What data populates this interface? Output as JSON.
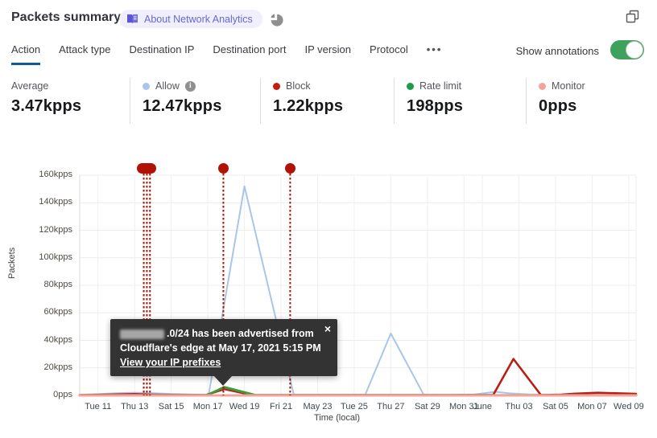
{
  "header": {
    "title": "Packets summary",
    "badge_label": "About Network Analytics",
    "icons": {
      "book_icon": "open-book",
      "pie_icon": "pie-chart",
      "popout_icon": "overlapping-windows"
    }
  },
  "tabs": {
    "items": [
      "Action",
      "Attack type",
      "Destination IP",
      "Destination port",
      "IP version",
      "Protocol"
    ],
    "active": "Action",
    "more_label": "•••"
  },
  "annotations_toggle": {
    "label": "Show annotations",
    "state": "on"
  },
  "stats": [
    {
      "label": "Average",
      "value": "3.47kpps",
      "dot_color": null,
      "has_info": false
    },
    {
      "label": "Allow",
      "value": "12.47kpps",
      "dot_color": "#a9c6e9",
      "has_info": true
    },
    {
      "label": "Block",
      "value": "1.22kpps",
      "dot_color": "#c21b10",
      "has_info": false
    },
    {
      "label": "Rate limit",
      "value": "198pps",
      "dot_color": "#1f9c49",
      "has_info": false
    },
    {
      "label": "Monitor",
      "value": "0pps",
      "dot_color": "#f5a49c",
      "has_info": false
    }
  ],
  "colors": {
    "tab_underline": "#115a93",
    "toggle_on": "#3da35c",
    "badge_text": "#6b66d9",
    "badge_bg": "#f0effd",
    "annotation_red": "#b01205"
  },
  "tooltip": {
    "line1_suffix": ".0/24 has been advertised from",
    "line2": "Cloudflare's edge at May 17, 2021 5:15 PM",
    "link": "View your IP prefixes",
    "close": "×",
    "ip_redacted": true
  },
  "chart_data": {
    "type": "line",
    "xlabel": "Time (local)",
    "ylabel": "Packets",
    "x_domain_note": "days since May 10 2021, 0 to 30.4",
    "ylim_kpps": [
      0,
      160
    ],
    "grid": true,
    "annotation_color": "#a81505",
    "y_ticks": [
      {
        "v": 0,
        "label": "0pps"
      },
      {
        "v": 20,
        "label": "20kpps"
      },
      {
        "v": 40,
        "label": "40kpps"
      },
      {
        "v": 60,
        "label": "60kpps"
      },
      {
        "v": 80,
        "label": "80kpps"
      },
      {
        "v": 100,
        "label": "100kpps"
      },
      {
        "v": 120,
        "label": "120kpps"
      },
      {
        "v": 140,
        "label": "140kpps"
      },
      {
        "v": 160,
        "label": "160kpps"
      }
    ],
    "x_ticks": [
      {
        "d": 1,
        "label": "Tue 11"
      },
      {
        "d": 3,
        "label": "Thu 13"
      },
      {
        "d": 5,
        "label": "Sat 15"
      },
      {
        "d": 7,
        "label": "Mon 17"
      },
      {
        "d": 9,
        "label": "Wed 19"
      },
      {
        "d": 11,
        "label": "Fri 21"
      },
      {
        "d": 13,
        "label": "May 23"
      },
      {
        "d": 15,
        "label": "Tue 25"
      },
      {
        "d": 17,
        "label": "Thu 27"
      },
      {
        "d": 19,
        "label": "Sat 29"
      },
      {
        "d": 21,
        "label": "Mon 31"
      },
      {
        "d": 22,
        "label": "June"
      },
      {
        "d": 24,
        "label": "Thu 03"
      },
      {
        "d": 26,
        "label": "Sat 05"
      },
      {
        "d": 28,
        "label": "Mon 07"
      },
      {
        "d": 30,
        "label": "Wed 09"
      }
    ],
    "series": [
      {
        "name": "Allow",
        "color": "#a9c6e9",
        "width": 2,
        "points": [
          [
            0,
            0.4
          ],
          [
            1,
            1
          ],
          [
            2,
            1.6
          ],
          [
            3,
            2
          ],
          [
            4,
            1.6
          ],
          [
            5,
            1.1
          ],
          [
            6,
            0.7
          ],
          [
            6.9,
            0.4
          ],
          [
            7.05,
            0.6
          ],
          [
            9,
            152
          ],
          [
            11.7,
            0.5
          ],
          [
            13,
            0.4
          ],
          [
            15.6,
            0.4
          ],
          [
            17,
            45
          ],
          [
            18.8,
            0.4
          ],
          [
            20,
            0.3
          ],
          [
            21.5,
            0.6
          ],
          [
            22.1,
            1.6
          ],
          [
            22.7,
            2.6
          ],
          [
            23.5,
            1.5
          ],
          [
            24.5,
            0.8
          ],
          [
            26,
            0.5
          ],
          [
            28,
            0.5
          ],
          [
            30.4,
            0.5
          ]
        ]
      },
      {
        "name": "Block",
        "color": "#bb1d12",
        "width": 2.6,
        "points": [
          [
            0,
            0.3
          ],
          [
            1,
            0.4
          ],
          [
            2.5,
            0.8
          ],
          [
            3,
            1
          ],
          [
            4,
            0.6
          ],
          [
            5,
            0.4
          ],
          [
            6.9,
            0.3
          ],
          [
            7.9,
            4.6
          ],
          [
            9.4,
            0.3
          ],
          [
            13,
            0.25
          ],
          [
            20,
            0.25
          ],
          [
            22.6,
            0.4
          ],
          [
            23.7,
            26.5
          ],
          [
            25.2,
            0.3
          ],
          [
            26.3,
            0.5
          ],
          [
            27,
            1.2
          ],
          [
            28.3,
            1.9
          ],
          [
            29.3,
            1.6
          ],
          [
            30.4,
            1.1
          ]
        ]
      },
      {
        "name": "Rate limit",
        "color": "#3f9b3a",
        "width": 3,
        "points": [
          [
            0,
            0.05
          ],
          [
            6.95,
            0.1
          ],
          [
            7.9,
            6
          ],
          [
            9.6,
            0.15
          ],
          [
            30.4,
            0.05
          ]
        ]
      },
      {
        "name": "Monitor",
        "color": "#f5a49c",
        "width": 3,
        "points": [
          [
            0,
            0
          ],
          [
            30.4,
            0
          ]
        ]
      }
    ],
    "annotations": [
      {
        "d": 3.67,
        "marker": "pill",
        "lines": [
          3.5,
          3.67,
          3.84
        ]
      },
      {
        "d": 7.85,
        "marker": "dot",
        "lines": [
          7.85
        ]
      },
      {
        "d": 11.5,
        "marker": "dot",
        "lines": [
          11.5
        ]
      }
    ]
  }
}
